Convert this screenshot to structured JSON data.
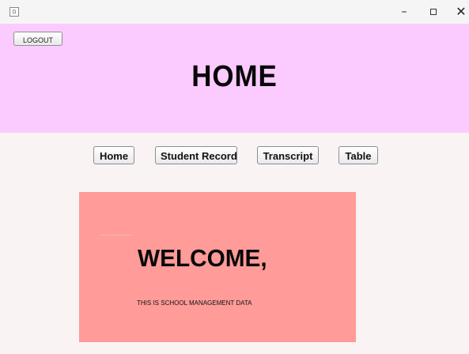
{
  "window": {
    "icons": {
      "app": "java-cup-icon",
      "minimize": "minimize-icon",
      "maximize": "maximize-icon",
      "close": "close-icon"
    },
    "controls": {
      "minimize": "–",
      "close": "✕"
    }
  },
  "header": {
    "background": "#fbcbff",
    "logout_label": "LOGOUT",
    "title": "HOME"
  },
  "nav": {
    "items": [
      {
        "label": "Home"
      },
      {
        "label": "Student Record"
      },
      {
        "label": "Transcript"
      },
      {
        "label": "Table"
      }
    ]
  },
  "welcome": {
    "background": "#ff9b98",
    "heading": "WELCOME,",
    "subtitle": "THIS IS SCHOOL MANAGEMENT DATA"
  }
}
